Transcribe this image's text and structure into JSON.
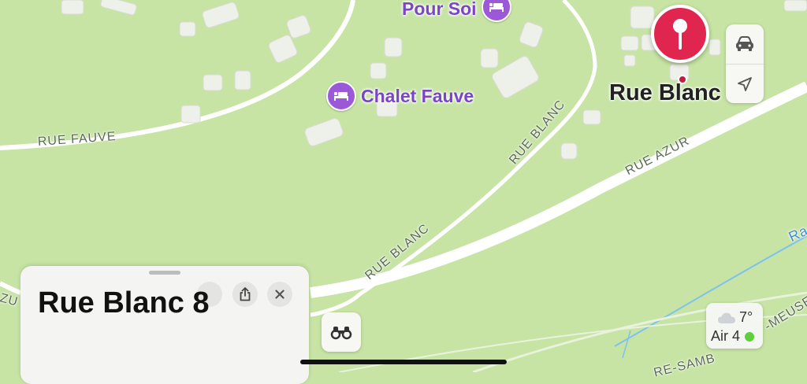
{
  "pois": [
    {
      "name": "Pour Soi",
      "icon": "bed-icon"
    },
    {
      "name": "Chalet Fauve",
      "icon": "bed-icon"
    }
  ],
  "streets": {
    "rue_fauve": "RUE FAUVE",
    "rue_blanc_upper": "RUE BLANC",
    "rue_blanc_lower": "RUE BLANC",
    "rue_azur": "RUE AZUR",
    "rue_azur_partial": "ZU",
    "river_partial": "Ra",
    "meuse_partial": "-MEUSE",
    "samb_partial": "RE-SAMB"
  },
  "pin": {
    "label": "Rue Blanc",
    "color": "#e0264e"
  },
  "map_controls": {
    "drive_icon": "car-icon",
    "location_icon": "location-arrow-icon"
  },
  "sheet": {
    "title": "Rue Blanc 8",
    "share_icon": "share-icon",
    "close_icon": "close-icon"
  },
  "binoculars_icon": "binoculars-icon",
  "weather": {
    "temperature": "7°",
    "air_quality": "Air 4",
    "aq_color": "#5ccf3a",
    "icon": "cloud-icon"
  },
  "colors": {
    "land": "#c7e4a5",
    "road": "#ffffff",
    "building": "#eef0ea",
    "river": "#7ec3ee",
    "poi": "#9b59d8"
  }
}
